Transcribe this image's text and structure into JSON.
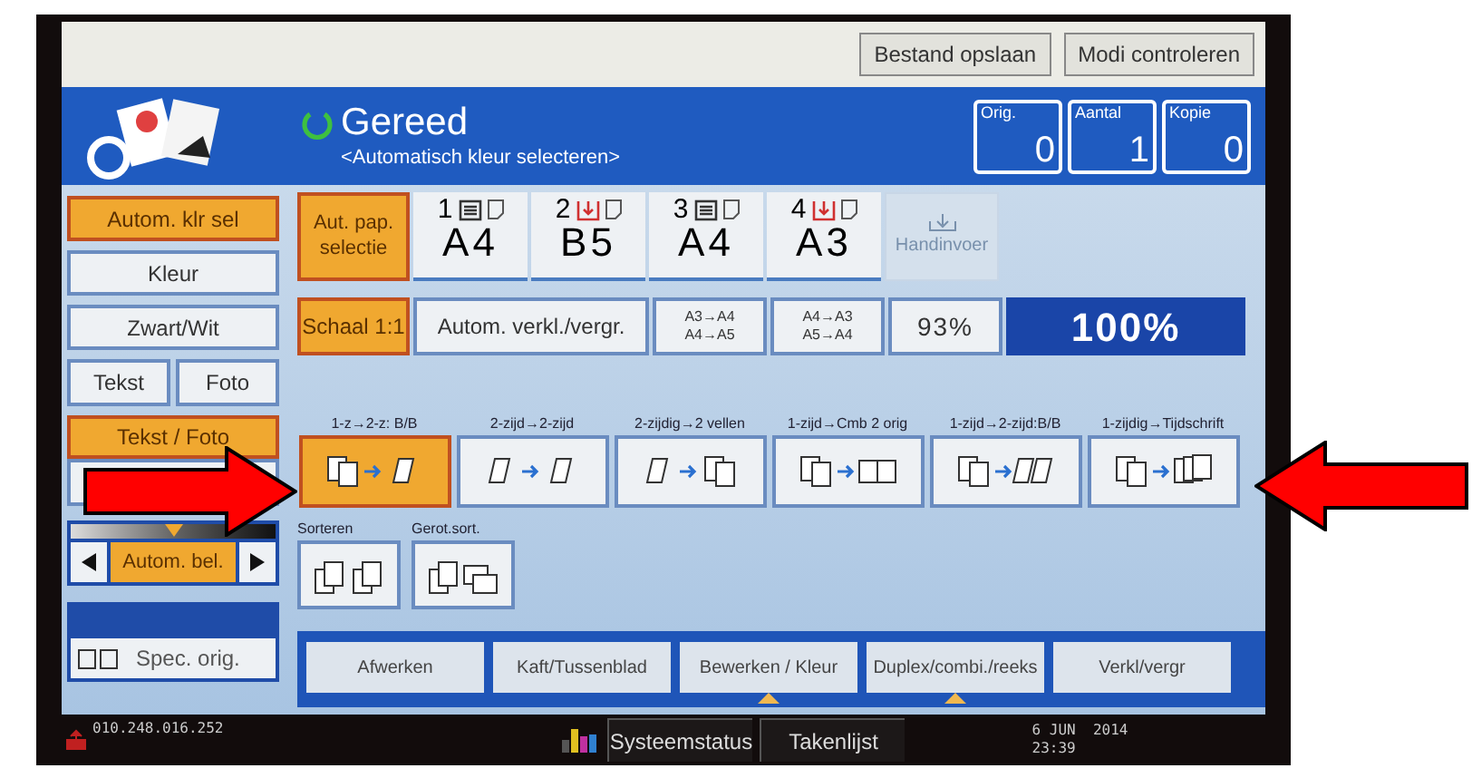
{
  "header_buttons": [
    {
      "label": "Bestand opslaan"
    },
    {
      "label": "Modi controleren"
    }
  ],
  "status": {
    "title": "Gereed",
    "subtitle": "<Automatisch kleur selecteren>"
  },
  "counters": [
    {
      "label": "Orig.",
      "value": "0"
    },
    {
      "label": "Aantal",
      "value": "1"
    },
    {
      "label": "Kopie",
      "value": "0"
    }
  ],
  "color_modes": [
    {
      "label": "Autom. klr sel",
      "selected": true
    },
    {
      "label": "Kleur",
      "selected": false
    },
    {
      "label": "Zwart/Wit",
      "selected": false
    }
  ],
  "original_types": [
    {
      "label": "Tekst",
      "selected": false
    },
    {
      "label": "Foto",
      "selected": false
    },
    {
      "label": "Tekst / Foto",
      "selected": true
    }
  ],
  "density": {
    "label": "Autom. bel.",
    "selected": true,
    "level": 0.5
  },
  "special_original": {
    "label": "Spec. orig."
  },
  "paper": {
    "label": "Aut. pap. selectie",
    "selected": true
  },
  "trays": [
    {
      "number": "1",
      "size": "A4",
      "kind": "stack",
      "selected": false
    },
    {
      "number": "2",
      "size": "B5",
      "kind": "feed",
      "selected": false
    },
    {
      "number": "3",
      "size": "A4",
      "kind": "stack",
      "selected": false
    },
    {
      "number": "4",
      "size": "A3",
      "kind": "feed",
      "selected": false
    }
  ],
  "bypass": {
    "label": "Handinvoer",
    "disabled": true
  },
  "scale": [
    {
      "label": "Schaal 1:1",
      "kind": "text",
      "selected": true
    },
    {
      "label": "Autom. verkl./vergr.",
      "kind": "text",
      "selected": false
    },
    {
      "lines": [
        "A3→A4",
        "A4→A5"
      ],
      "kind": "lines",
      "selected": false
    },
    {
      "lines": [
        "A4→A3",
        "A5→A4"
      ],
      "kind": "lines",
      "selected": false
    },
    {
      "label": "93%",
      "kind": "text",
      "selected": false
    }
  ],
  "ratio": "100%",
  "duplex": [
    {
      "label": "1-z→2-z: B/B",
      "kind": "pages-flip",
      "selected": true
    },
    {
      "label": "2-zijd→2-zijd",
      "kind": "flip-flip",
      "selected": false
    },
    {
      "label": "2-zijdig→2 vellen",
      "kind": "flip-pages",
      "selected": false
    },
    {
      "label": "1-zijd→Cmb 2 orig",
      "kind": "pages-combine",
      "selected": false
    },
    {
      "label": "1-zijd→2-zijd:B/B",
      "kind": "pages-spread",
      "selected": false
    },
    {
      "label": "1-zijdig→Tijdschrift",
      "kind": "pages-magazine",
      "selected": false
    }
  ],
  "sort": [
    {
      "label": "Sorteren",
      "kind": "sort",
      "selected": false
    },
    {
      "label": "Gerot.sort.",
      "kind": "rotate",
      "selected": false
    }
  ],
  "tabs": [
    {
      "label": "Afwerken",
      "flag": false
    },
    {
      "label": "Kaft/Tussenblad",
      "flag": false
    },
    {
      "label": "Bewerken / Kleur",
      "flag": true
    },
    {
      "label": "Duplex/combi./reeks",
      "flag": true
    },
    {
      "label": "Verkl/vergr",
      "flag": false
    }
  ],
  "status_bar": {
    "address": "010.248.016.252",
    "buttons": [
      {
        "label": "Systeemstatus"
      },
      {
        "label": "Takenlijst"
      }
    ],
    "date": "6 JUN  2014",
    "time": "23:39"
  }
}
